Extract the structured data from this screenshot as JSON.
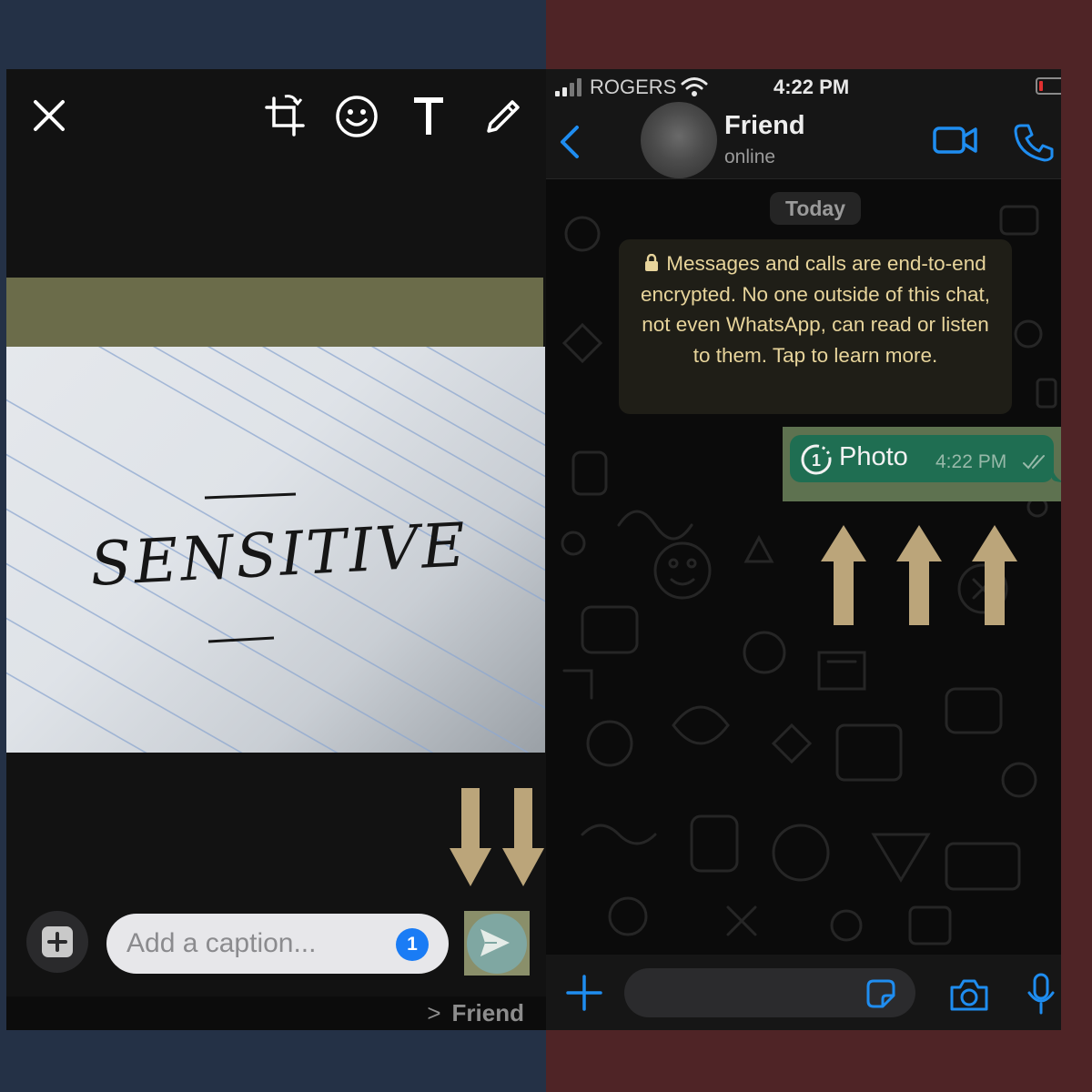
{
  "editor": {
    "caption_placeholder": "Add a caption...",
    "view_once_badge": "1",
    "recipient": "Friend",
    "recipient_chevron": ">",
    "photo_text": "SENSITIVE",
    "icons": [
      "close-icon",
      "crop-rotate-icon",
      "emoji-icon",
      "text-icon",
      "pencil-icon",
      "add-media-icon",
      "send-icon"
    ]
  },
  "chat": {
    "status_bar": {
      "carrier": "ROGERS",
      "time": "4:22 PM"
    },
    "contact": {
      "name": "Friend",
      "status": "online"
    },
    "date_label": "Today",
    "encryption_notice": "Messages and calls are end-to-end encrypted. No one outside of this chat, not even WhatsApp, can read or listen to them. Tap to learn more.",
    "message": {
      "text": "Photo",
      "time": "4:22 PM",
      "view_once_count": "1"
    },
    "icons": [
      "back-icon",
      "video-call-icon",
      "phone-call-icon",
      "plus-icon",
      "sticker-icon",
      "camera-icon",
      "mic-icon"
    ]
  },
  "colors": {
    "accent_blue": "#1f8df0",
    "bubble_green": "#1f6e52",
    "notice_text": "#e7d49b",
    "annotation_arrow": "#bba57a",
    "left_backdrop": "#243146",
    "right_backdrop": "#4f2426"
  }
}
